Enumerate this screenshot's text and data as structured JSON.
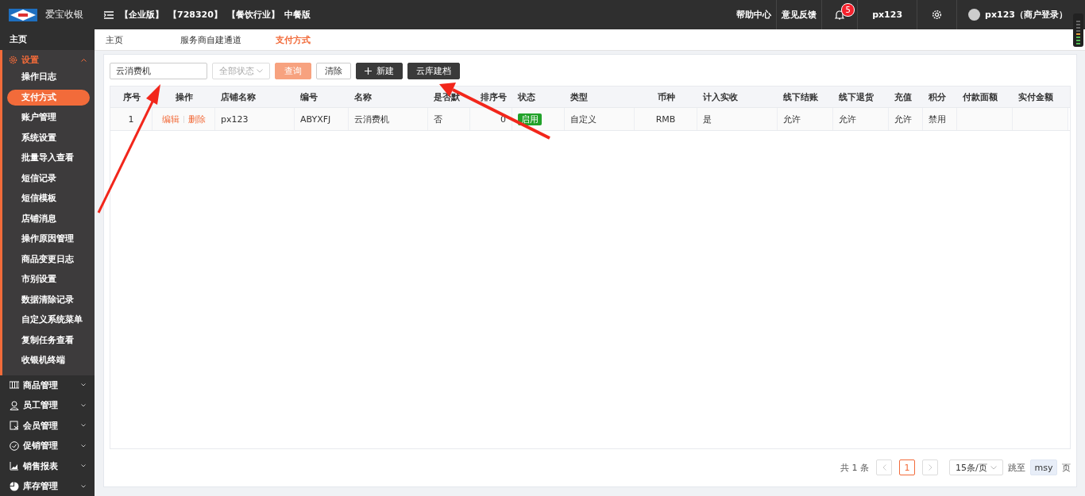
{
  "topbar": {
    "app_name": "爱宝收银",
    "tags": [
      "【企业版】",
      "【728320】",
      "【餐饮行业】",
      "中餐版"
    ],
    "links": [
      "帮助中心",
      "意见反馈"
    ],
    "notification_count": "5",
    "user_short": "px123",
    "user": "px123（商户登录）"
  },
  "sidebar": {
    "home": "主页",
    "section": {
      "label": "设置",
      "expanded": true,
      "items": [
        {
          "label": "操作日志",
          "selected": false
        },
        {
          "label": "支付方式",
          "selected": true
        },
        {
          "label": "账户管理",
          "selected": false
        },
        {
          "label": "系统设置",
          "selected": false
        },
        {
          "label": "批量导入查看",
          "selected": false
        },
        {
          "label": "短信记录",
          "selected": false
        },
        {
          "label": "短信模板",
          "selected": false
        },
        {
          "label": "店铺消息",
          "selected": false
        },
        {
          "label": "操作原因管理",
          "selected": false
        },
        {
          "label": "商品变更日志",
          "selected": false
        },
        {
          "label": "市别设置",
          "selected": false
        },
        {
          "label": "数据清除记录",
          "selected": false
        },
        {
          "label": "自定义系统菜单",
          "selected": false
        },
        {
          "label": "复制任务查看",
          "selected": false
        },
        {
          "label": "收银机终端",
          "selected": false
        }
      ]
    },
    "groups": [
      {
        "label": "商品管理",
        "kind": "barcode"
      },
      {
        "label": "员工管理",
        "kind": "person"
      },
      {
        "label": "会员管理",
        "kind": "card"
      },
      {
        "label": "促销管理",
        "kind": "check"
      },
      {
        "label": "销售报表",
        "kind": "chart"
      },
      {
        "label": "库存管理",
        "kind": "pie"
      }
    ]
  },
  "tabs": [
    {
      "label": "主页",
      "selected": false
    },
    {
      "label": "服务商自建通道",
      "selected": false
    },
    {
      "label": "支付方式",
      "selected": true
    }
  ],
  "toolbar": {
    "search_value": "云消费机",
    "status_placeholder": "全部状态",
    "buttons": [
      "查询",
      "清除",
      "新建",
      "云库建档"
    ]
  },
  "table": {
    "columns": [
      "序号",
      "操作",
      "店铺名称",
      "编号",
      "名称",
      "是否默",
      "排序号",
      "状态",
      "类型",
      "币种",
      "计入实收",
      "线下结账",
      "线下退货",
      "充值",
      "积分",
      "付款面额",
      "实付金额"
    ],
    "rows": [
      {
        "index": "1",
        "actions": [
          "编辑",
          "删除"
        ],
        "store": "px123",
        "code": "ABYXFJ",
        "name": "云消费机",
        "default": "否",
        "order": "0",
        "status": "启用",
        "type": "自定义",
        "currency": "RMB",
        "counted": "是",
        "offline_checkout": "允许",
        "offline_return": "允许",
        "recharge": "允许",
        "points": "禁用",
        "face_value": "",
        "paid_amount": ""
      }
    ]
  },
  "pagination": {
    "total": "共 1 条",
    "pages": [
      {
        "label": "1",
        "selected": true
      }
    ],
    "page_size": "15条/页",
    "goto_label": "跳至",
    "goto_value": "msy",
    "page_suffix": "页"
  }
}
